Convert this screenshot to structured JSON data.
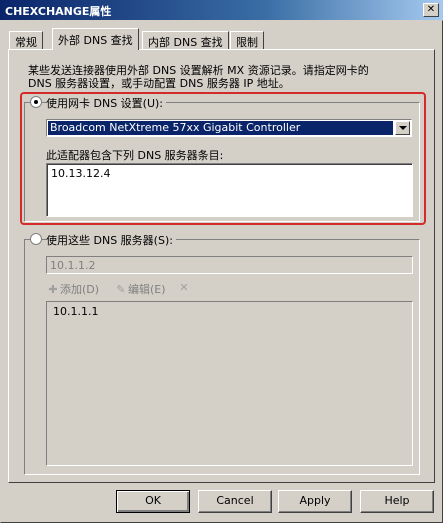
{
  "window": {
    "title": "CHEXCHANGE属性",
    "close_glyph": "✕"
  },
  "tabs": [
    {
      "label": "常规"
    },
    {
      "label": "外部 DNS 查找"
    },
    {
      "label": "内部 DNS 查找"
    },
    {
      "label": "限制"
    }
  ],
  "description_line1": "某些发送连接器使用外部 DNS 设置解析 MX 资源记录。请指定网卡的",
  "description_line2": "DNS 服务器设置，或手动配置 DNS 服务器 IP 地址。",
  "option_nic": {
    "label": "使用网卡 DNS 设置(U):",
    "selected": true,
    "adapter": "Broadcom NetXtreme 57xx Gigabit Controller",
    "entries_label": "此适配器包含下列 DNS 服务器条目:",
    "entries": [
      "10.13.12.4"
    ]
  },
  "option_manual": {
    "label": "使用这些 DNS 服务器(S):",
    "selected": false,
    "input_value": "10.1.1.2",
    "add_label": "添加(D)",
    "edit_label": "编辑(E)",
    "servers": [
      "10.1.1.1"
    ]
  },
  "buttons": {
    "ok": "OK",
    "cancel": "Cancel",
    "apply": "Apply",
    "help": "Help"
  },
  "colors": {
    "highlight_box": "#d42a2a",
    "selection": "#0a246a",
    "title_bar": "#0a246a"
  }
}
